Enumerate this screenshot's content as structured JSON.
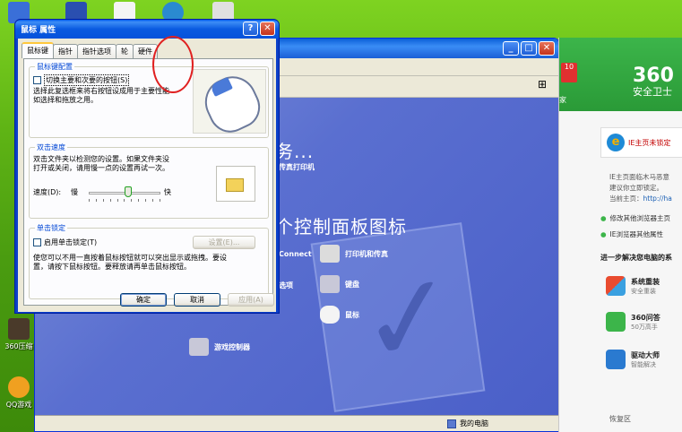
{
  "desktop": {
    "icons": [
      {
        "label": "",
        "name": "desktop-icon-1"
      },
      {
        "label": "360压缩",
        "name": "desktop-icon-360zip"
      },
      {
        "label": "QQ游戏",
        "name": "desktop-icon-qqgame"
      }
    ]
  },
  "control_panel": {
    "heading_tasks": "务...",
    "heading_icons": "个控制面板图标",
    "items": [
      {
        "label": "传真打印机"
      },
      {
        "label": "Connect"
      },
      {
        "label": "打印机和传真"
      },
      {
        "label": "选项"
      },
      {
        "label": "键盘"
      },
      {
        "label": "鼠标"
      },
      {
        "label": "游戏控制器"
      }
    ],
    "status_label": "我的电脑",
    "tab_badge": "10",
    "side_label": "家"
  },
  "panel360": {
    "logo": "360",
    "logo_sub": "安全卫士",
    "ie_title": "IE主页未锁定",
    "desc1": "IE主页面临木马恶意",
    "desc2": "建议你立即锁定。",
    "desc3": "当前主页：",
    "desc3_link": "http://ha",
    "bullet1": "修改其他浏览器主页",
    "bullet2": "IE浏览器其他属性",
    "section": "进一步解决您电脑的系",
    "tools": [
      {
        "title": "系统重装",
        "sub": "安全重装"
      },
      {
        "title": "360问答",
        "sub": "50万高手"
      },
      {
        "title": "驱动大师",
        "sub": "智能解决"
      }
    ],
    "bottom": "恢复区"
  },
  "dialog": {
    "title": "鼠标 属性",
    "help_btn": "?",
    "close_btn": "✕",
    "tabs": [
      "鼠标键",
      "指针",
      "指针选项",
      "轮",
      "硬件"
    ],
    "group_buttons": {
      "label": "鼠标键配置",
      "checkbox": "切换主要和次要的按钮(S)",
      "desc1": "选择此复选框来将右按钮设成用于主要性能",
      "desc2": "如选择和拖放之用。"
    },
    "group_speed": {
      "label": "双击速度",
      "desc1": "双击文件夹以检测您的设置。如果文件夹没",
      "desc2": "打开或关闭，请用慢一点的设置再试一次。",
      "speed_label": "速度(D):",
      "slow": "慢",
      "fast": "快",
      "speed_value": 0.55
    },
    "group_lock": {
      "label": "单击锁定",
      "checkbox": "启用单击锁定(T)",
      "settings_btn": "设置(E)...",
      "desc1": "使您可以不用一直按着鼠标按钮就可以突出显示或拖拽。要设",
      "desc2": "置，请按下鼠标按钮。要释放请再单击鼠标按钮。"
    },
    "buttons": {
      "ok": "确定",
      "cancel": "取消",
      "apply": "应用(A)"
    }
  }
}
